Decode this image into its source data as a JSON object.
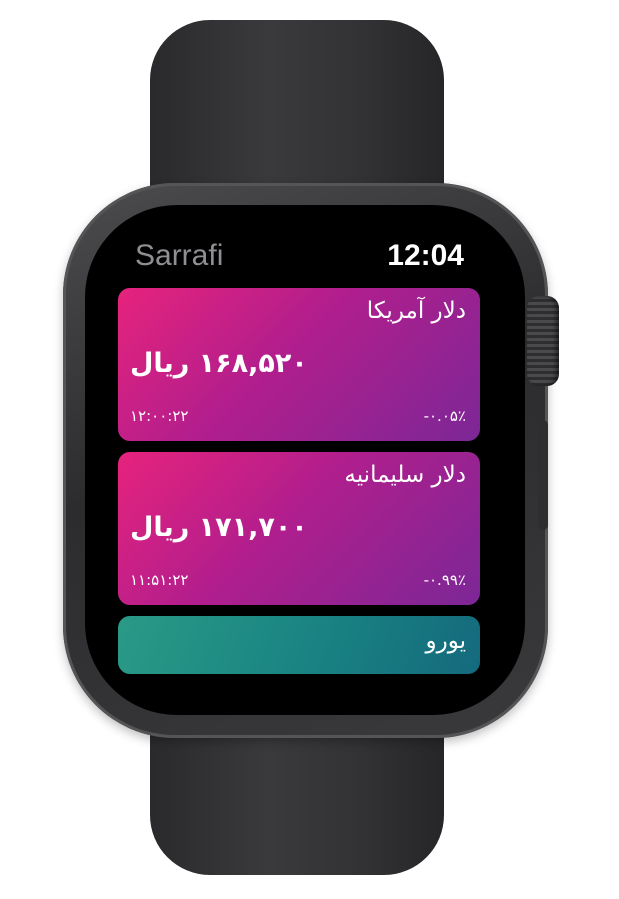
{
  "app": {
    "name": "Sarrafi",
    "time": "12:04"
  },
  "cards": [
    {
      "title": "دلار آمریکا",
      "price": "۱۶۸,۵۲۰ ریال",
      "time": "۱۲:۰۰:۲۲",
      "change": "-۰.۰۵٪"
    },
    {
      "title": "دلار سلیمانیه",
      "price": "۱۷۱,۷۰۰ ریال",
      "time": "۱۱:۵۱:۲۲",
      "change": "-۰.۹۹٪"
    },
    {
      "title": "یورو"
    }
  ],
  "colors": {
    "card_gradient_start": "#e6237c",
    "card_gradient_end": "#7c2796",
    "teal_gradient_start": "#2a9a86",
    "teal_gradient_end": "#146a7d",
    "screen": "#000000"
  }
}
